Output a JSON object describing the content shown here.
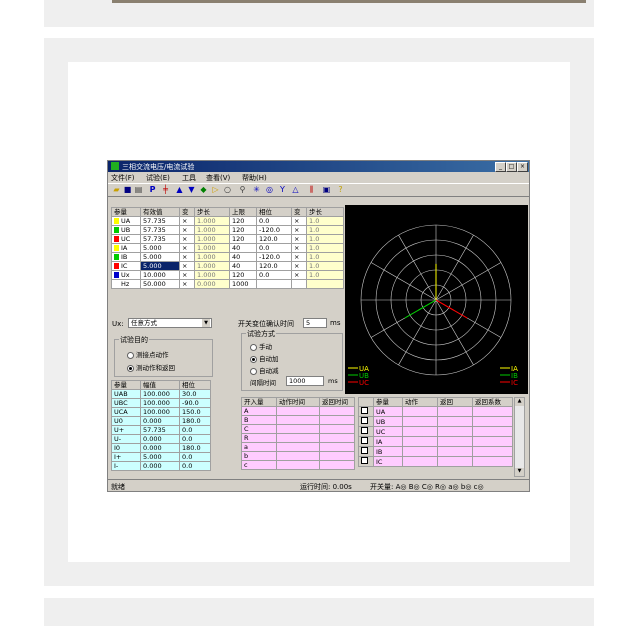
{
  "window": {
    "title": "三相交流电压/电流试验",
    "minimize": "_",
    "maximize": "□",
    "close": "×"
  },
  "menu": [
    "文件(F)",
    "试验(E)",
    "工具",
    "查看(V)",
    "帮助(H)"
  ],
  "toolbar_icons": [
    "open-icon",
    "save-icon",
    "print-icon",
    "p-icon",
    "cross-icon",
    "up-arrow-icon",
    "down-arrow-icon",
    "step-icon",
    "play-icon",
    "stop-icon",
    "zoom-icon",
    "snowflake-icon",
    "target-icon",
    "y-icon",
    "delta-icon",
    "bar-icon",
    "monitor-icon",
    "help-icon"
  ],
  "colors": {
    "UA": "#ffff00",
    "UB": "#00cc00",
    "UC": "#ff0000",
    "IA": "#ffff00",
    "IB": "#00cc00",
    "IC": "#ff0000",
    "Ux": "#0000cc",
    "Hz": "#ffffff"
  },
  "params": {
    "headers": [
      "参量",
      "有效值",
      "变",
      "步长",
      "上限",
      "相位",
      "变",
      "步长"
    ],
    "rows": [
      [
        "UA",
        "57.735",
        "×",
        "1.000",
        "120",
        "0.0",
        "×",
        "1.0"
      ],
      [
        "UB",
        "57.735",
        "×",
        "1.000",
        "120",
        "-120.0",
        "×",
        "1.0"
      ],
      [
        "UC",
        "57.735",
        "×",
        "1.000",
        "120",
        "120.0",
        "×",
        "1.0"
      ],
      [
        "IA",
        "5.000",
        "×",
        "1.000",
        "40",
        "0.0",
        "×",
        "1.0"
      ],
      [
        "IB",
        "5.000",
        "×",
        "1.000",
        "40",
        "-120.0",
        "×",
        "1.0"
      ],
      [
        "IC",
        "5.000",
        "×",
        "1.000",
        "40",
        "120.0",
        "×",
        "1.0"
      ],
      [
        "Ux",
        "10.000",
        "×",
        "1.000",
        "120",
        "0.0",
        "×",
        "1.0"
      ],
      [
        "Hz",
        "50.000",
        "×",
        "0.000",
        "1000",
        "",
        "",
        ""
      ]
    ]
  },
  "ux": {
    "label": "Ux:",
    "value": "任意方式"
  },
  "confirm": {
    "label": "开关变位确认时间",
    "value": "5",
    "unit": "ms"
  },
  "purpose": {
    "title": "试验目的",
    "opt1": "测接点动作",
    "opt2": "测动作和返回"
  },
  "mode": {
    "title": "试验方式",
    "opt1": "手动",
    "opt2": "自动加",
    "opt3": "自动减",
    "interval_label": "间隔时间",
    "interval_value": "1000",
    "interval_unit": "ms"
  },
  "seq": {
    "headers": [
      "参量",
      "幅值",
      "相位"
    ],
    "rows": [
      [
        "UAB",
        "100.000",
        "30.0"
      ],
      [
        "UBC",
        "100.000",
        "-90.0"
      ],
      [
        "UCA",
        "100.000",
        "150.0"
      ],
      [
        "U0",
        "0.000",
        "180.0"
      ],
      [
        "U+",
        "57.735",
        "0.0"
      ],
      [
        "U-",
        "0.000",
        "0.0"
      ],
      [
        "I0",
        "0.000",
        "180.0"
      ],
      [
        "I+",
        "5.000",
        "0.0"
      ],
      [
        "I-",
        "0.000",
        "0.0"
      ]
    ]
  },
  "switch": {
    "headers": [
      "开入量",
      "动作时间",
      "返回时间"
    ],
    "rows": [
      "A",
      "B",
      "C",
      "R",
      "a",
      "b",
      "c"
    ]
  },
  "result": {
    "headers": [
      "参量",
      "动作",
      "返回",
      "返回系数"
    ],
    "rows": [
      "UA",
      "UB",
      "UC",
      "IA",
      "IB",
      "IC"
    ]
  },
  "legend_left": [
    "UA",
    "UB",
    "UC"
  ],
  "legend_right": [
    "IA",
    "IB",
    "IC"
  ],
  "status": {
    "ready": "就绪",
    "runtime": "运行时间: 0.00s",
    "switches": "开关量: A◎ B◎ C◎ R◎ a◎ b◎ c◎"
  }
}
